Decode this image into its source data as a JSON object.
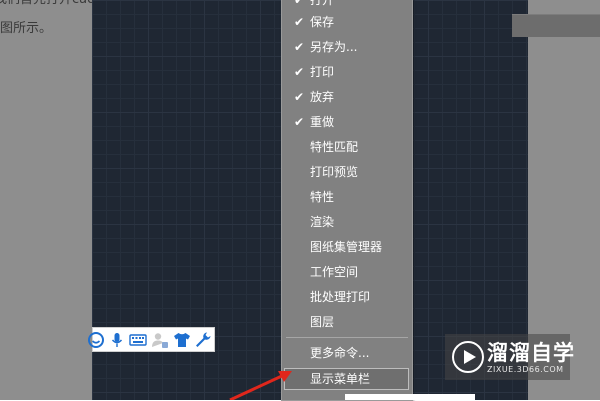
{
  "article": {
    "line1": "我们首先打开cad",
    "line2": "图所示。"
  },
  "menu": {
    "items": [
      {
        "label": "打开",
        "checked": true
      },
      {
        "label": "保存",
        "checked": true
      },
      {
        "label": "另存为...",
        "checked": true
      },
      {
        "label": "打印",
        "checked": true
      },
      {
        "label": "放弃",
        "checked": true
      },
      {
        "label": "重做",
        "checked": true
      },
      {
        "label": "特性匹配",
        "checked": false
      },
      {
        "label": "打印预览",
        "checked": false
      },
      {
        "label": "特性",
        "checked": false
      },
      {
        "label": "渲染",
        "checked": false
      },
      {
        "label": "图纸集管理器",
        "checked": false
      },
      {
        "label": "工作空间",
        "checked": false
      },
      {
        "label": "批处理打印",
        "checked": false
      },
      {
        "label": "图层",
        "checked": false
      }
    ],
    "more_commands": "更多命令...",
    "show_menubar": "显示菜单栏",
    "check_glyph": "✔"
  },
  "toolbar": {
    "icons": [
      "smiley-icon",
      "microphone-icon",
      "keyboard-icon",
      "user-icon",
      "tshirt-icon",
      "wrench-icon"
    ]
  },
  "watermark": {
    "brand": "溜溜自学",
    "url": "ZIXUE.3D66.COM"
  },
  "colors": {
    "canvas_bg": "#1f2733",
    "menu_bg": "#818181",
    "toolbar_icon": "#1e6fd0",
    "arrow": "#e0271c"
  }
}
